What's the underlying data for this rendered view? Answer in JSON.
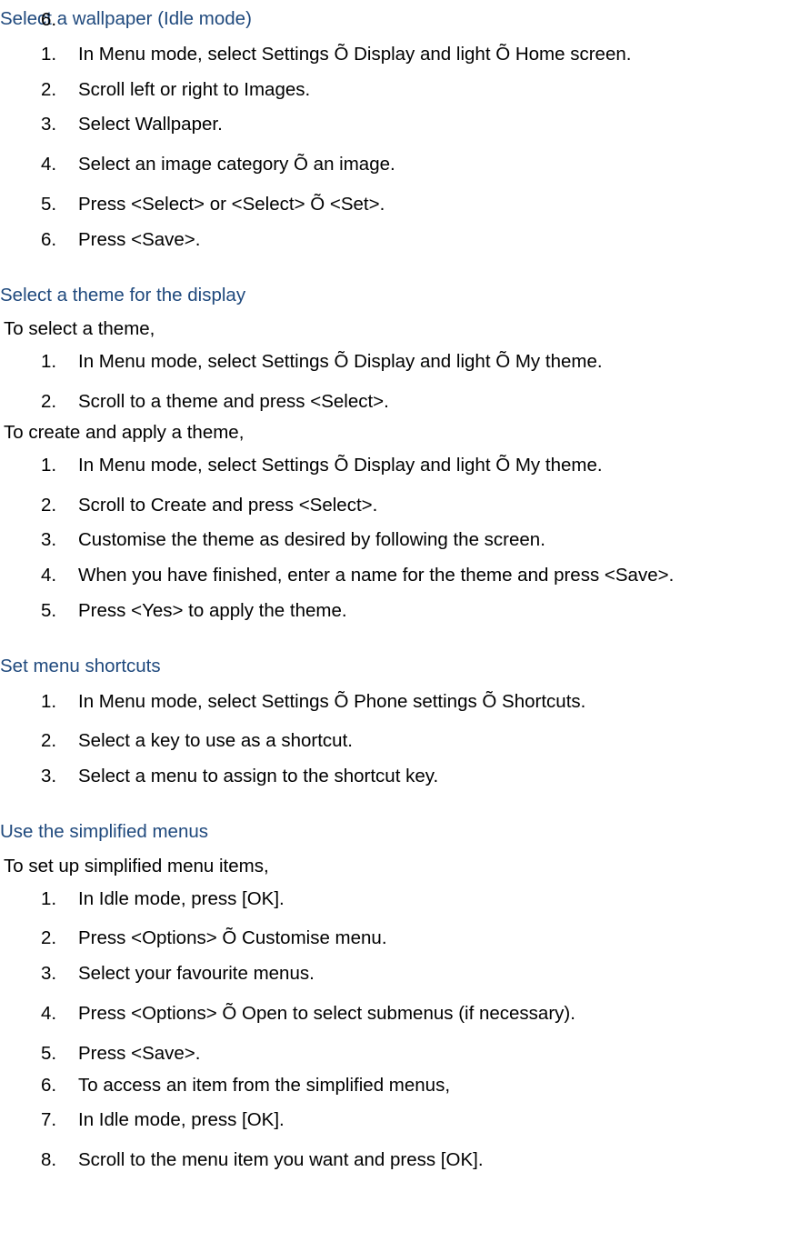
{
  "trailing": {
    "item6": ""
  },
  "section1": {
    "heading": "Select a wallpaper (Idle mode)",
    "items": [
      "In Menu mode, select Settings Õ Display and light Õ Home screen.",
      "Scroll left or right to Images.",
      "Select Wallpaper.",
      "Select an image category Õ an image.",
      "Press <Select> or <Select> Õ <Set>.",
      "Press <Save>."
    ]
  },
  "section2": {
    "heading": "Select a theme for the display",
    "intro1": "To select a theme,",
    "list1": [
      "In Menu mode, select Settings Õ Display and light Õ My theme.",
      "Scroll to a theme and press <Select>."
    ],
    "intro2": "To create and apply a theme,",
    "list2": [
      "In Menu mode, select Settings Õ Display and light Õ My theme.",
      "Scroll to Create and press <Select>.",
      "Customise the theme as desired by following the screen.",
      "When you have finished, enter a name for the theme and press <Save>.",
      "Press <Yes> to apply the theme."
    ]
  },
  "section3": {
    "heading": "Set menu shortcuts",
    "items": [
      "In Menu mode, select Settings Õ Phone settings Õ Shortcuts.",
      "Select a key to use as a shortcut.",
      "Select a menu to assign to the shortcut key."
    ]
  },
  "section4": {
    "heading": "Use the simplified menus",
    "intro": "To set up simplified menu items,",
    "items": [
      "In Idle mode, press [OK].",
      "Press <Options> Õ Customise menu.",
      "Select your favourite menus.",
      "Press <Options> Õ Open to select submenus (if necessary).",
      "Press <Save>.",
      "To access an item from the simplified menus,",
      "In Idle mode, press [OK].",
      "Scroll to the menu item you want and press [OK]."
    ]
  }
}
